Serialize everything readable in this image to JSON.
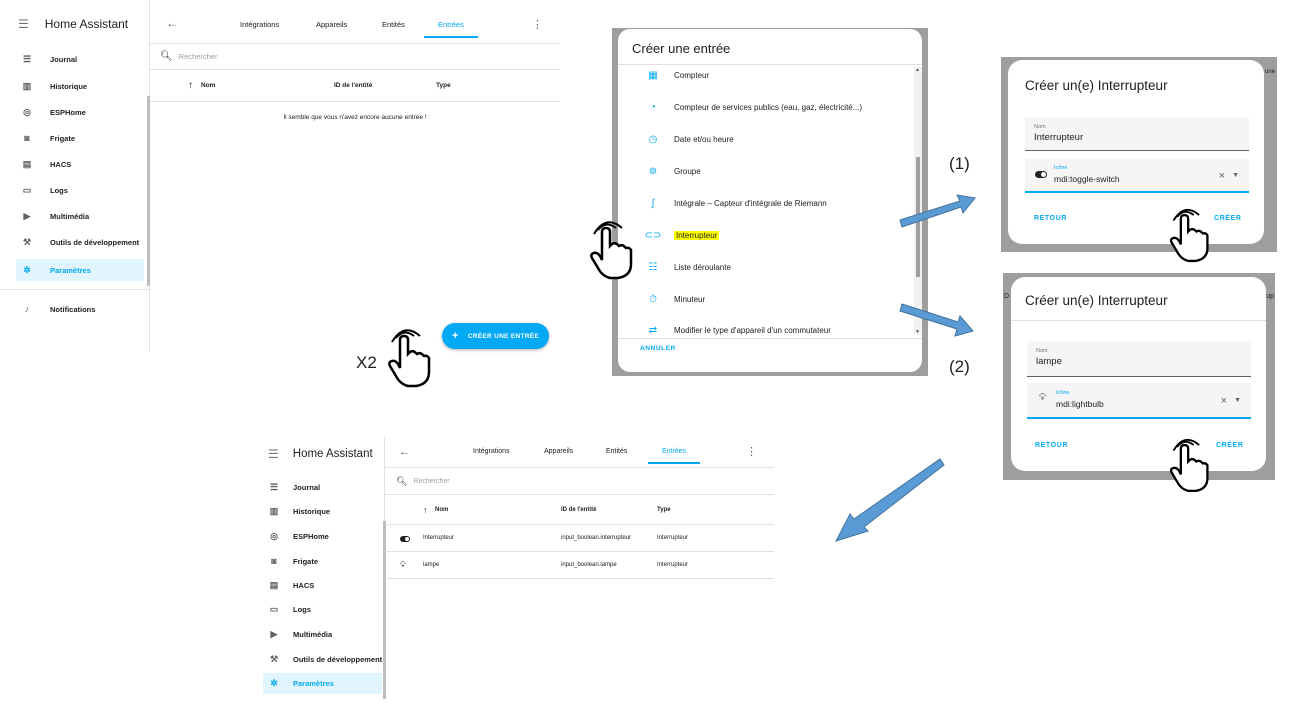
{
  "app": {
    "title": "Home Assistant"
  },
  "sidebar": {
    "items": [
      {
        "label": "Journal",
        "icon": "format-list-icon"
      },
      {
        "label": "Historique",
        "icon": "chart-bar-icon"
      },
      {
        "label": "ESPHome",
        "icon": "esphome-icon"
      },
      {
        "label": "Frigate",
        "icon": "camera-icon"
      },
      {
        "label": "HACS",
        "icon": "store-icon"
      },
      {
        "label": "Logs",
        "icon": "console-icon"
      },
      {
        "label": "Multimédia",
        "icon": "media-play-icon"
      },
      {
        "label": "Outils de développement",
        "icon": "hammer-icon"
      },
      {
        "label": "Paramètres",
        "icon": "gear-icon"
      }
    ],
    "notifications": "Notifications"
  },
  "tabs": [
    "Intégrations",
    "Appareils",
    "Entités",
    "Entrées"
  ],
  "active_tab": "Entrées",
  "search": {
    "placeholder": "Rechercher"
  },
  "table": {
    "headers": {
      "name": "Nom",
      "entity_id": "ID de l'entité",
      "type": "Type"
    },
    "empty_message": "Il semble que vous n'avez encore aucune entrée !",
    "rows": [
      {
        "name": "Interrupteur",
        "entity_id": "input_boolean.interrupteur",
        "type": "Interrupteur",
        "icon": "toggle-switch-icon"
      },
      {
        "name": "lampe",
        "entity_id": "input_boolean.lampe",
        "type": "Interrupteur",
        "icon": "lightbulb-icon"
      }
    ]
  },
  "fab": {
    "label": "CRÉER UNE ENTRÉE"
  },
  "annotations": {
    "x2": "X2",
    "step1": "(1)",
    "step2": "(2)"
  },
  "create_entry_dialog": {
    "title": "Créer une entrée",
    "items": [
      "Compteur",
      "Compteur de services publics (eau, gaz, électricité...)",
      "Date et/ou heure",
      "Groupe",
      "Intégrale – Capteur d'intégrale de Riemann",
      "Interrupteur",
      "Liste déroulante",
      "Minuteur",
      "Modifier le type d'appareil d'un commutateur"
    ],
    "cancel": "ANNULER"
  },
  "toggle_dialog_1": {
    "title": "Créer un(e) Interrupteur",
    "name_label": "Nom",
    "name_value": "Interrupteur",
    "icon_label": "Icône",
    "icon_value": "mdi:toggle-switch",
    "back": "RETOUR",
    "create": "CRÉER",
    "peek": "une"
  },
  "toggle_dialog_2": {
    "title": "Créer un(e) Interrupteur",
    "name_label": "Nom",
    "name_value": "lampe",
    "icon_label": "Icône",
    "icon_value": "mdi:lightbulb",
    "back": "RETOUR",
    "create": "CRÉER",
    "peek_left": "D",
    "peek_right": "rup"
  },
  "colors": {
    "accent": "#03a9f4",
    "arrow": "#5b9bd5",
    "highlight": "#ffff00"
  }
}
